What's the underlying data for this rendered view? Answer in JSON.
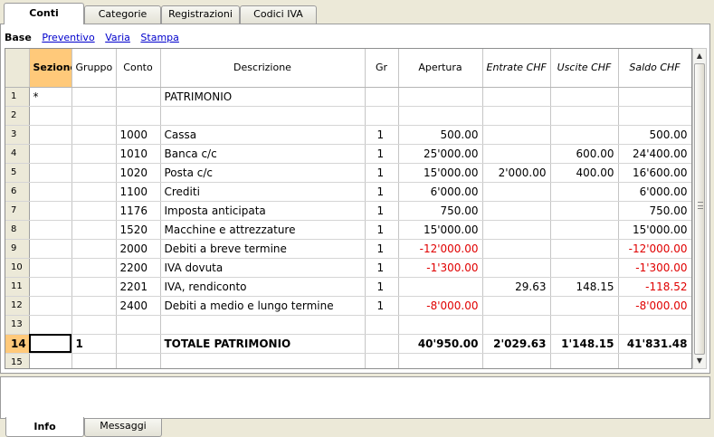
{
  "top_tabs": [
    "Conti",
    "Categorie",
    "Registrazioni",
    "Codici IVA"
  ],
  "views": {
    "active": "Base",
    "links": [
      "Preventivo",
      "Varia",
      "Stampa"
    ]
  },
  "columns": [
    "Sezione",
    "Gruppo",
    "Conto",
    "Descrizione",
    "Gr",
    "Apertura",
    "Entrate CHF",
    "Uscite CHF",
    "Saldo CHF"
  ],
  "rows": [
    {
      "n": "1",
      "sezione": "*",
      "gruppo": "",
      "conto": "",
      "descrizione": "PATRIMONIO",
      "gr": "",
      "apertura": "",
      "entrate": "",
      "uscite": "",
      "saldo": ""
    },
    {
      "n": "2",
      "sezione": "",
      "gruppo": "",
      "conto": "",
      "descrizione": "",
      "gr": "",
      "apertura": "",
      "entrate": "",
      "uscite": "",
      "saldo": ""
    },
    {
      "n": "3",
      "sezione": "",
      "gruppo": "",
      "conto": "1000",
      "descrizione": "Cassa",
      "gr": "1",
      "apertura": "500.00",
      "entrate": "",
      "uscite": "",
      "saldo": "500.00"
    },
    {
      "n": "4",
      "sezione": "",
      "gruppo": "",
      "conto": "1010",
      "descrizione": "Banca c/c",
      "gr": "1",
      "apertura": "25'000.00",
      "entrate": "",
      "uscite": "600.00",
      "saldo": "24'400.00"
    },
    {
      "n": "5",
      "sezione": "",
      "gruppo": "",
      "conto": "1020",
      "descrizione": "Posta c/c",
      "gr": "1",
      "apertura": "15'000.00",
      "entrate": "2'000.00",
      "uscite": "400.00",
      "saldo": "16'600.00"
    },
    {
      "n": "6",
      "sezione": "",
      "gruppo": "",
      "conto": "1100",
      "descrizione": "Crediti",
      "gr": "1",
      "apertura": "6'000.00",
      "entrate": "",
      "uscite": "",
      "saldo": "6'000.00"
    },
    {
      "n": "7",
      "sezione": "",
      "gruppo": "",
      "conto": "1176",
      "descrizione": "Imposta anticipata",
      "gr": "1",
      "apertura": "750.00",
      "entrate": "",
      "uscite": "",
      "saldo": "750.00"
    },
    {
      "n": "8",
      "sezione": "",
      "gruppo": "",
      "conto": "1520",
      "descrizione": "Macchine e attrezzature",
      "gr": "1",
      "apertura": "15'000.00",
      "entrate": "",
      "uscite": "",
      "saldo": "15'000.00"
    },
    {
      "n": "9",
      "sezione": "",
      "gruppo": "",
      "conto": "2000",
      "descrizione": "Debiti a breve termine",
      "gr": "1",
      "apertura": "-12'000.00",
      "entrate": "",
      "uscite": "",
      "saldo": "-12'000.00"
    },
    {
      "n": "10",
      "sezione": "",
      "gruppo": "",
      "conto": "2200",
      "descrizione": "IVA dovuta",
      "gr": "1",
      "apertura": "-1'300.00",
      "entrate": "",
      "uscite": "",
      "saldo": "-1'300.00"
    },
    {
      "n": "11",
      "sezione": "",
      "gruppo": "",
      "conto": "2201",
      "descrizione": "IVA, rendiconto",
      "gr": "1",
      "apertura": "",
      "entrate": "29.63",
      "uscite": "148.15",
      "saldo": "-118.52"
    },
    {
      "n": "12",
      "sezione": "",
      "gruppo": "",
      "conto": "2400",
      "descrizione": "Debiti a medio e lungo termine",
      "gr": "1",
      "apertura": "-8'000.00",
      "entrate": "",
      "uscite": "",
      "saldo": "-8'000.00"
    },
    {
      "n": "13",
      "sezione": "",
      "gruppo": "",
      "conto": "",
      "descrizione": "",
      "gr": "",
      "apertura": "",
      "entrate": "",
      "uscite": "",
      "saldo": ""
    },
    {
      "n": "14",
      "sezione": "",
      "gruppo": "1",
      "conto": "",
      "descrizione": "TOTALE PATRIMONIO",
      "gr": "",
      "apertura": "40'950.00",
      "entrate": "2'029.63",
      "uscite": "1'148.15",
      "saldo": "41'831.48"
    },
    {
      "n": "15",
      "sezione": "",
      "gruppo": "",
      "conto": "",
      "descrizione": "",
      "gr": "",
      "apertura": "",
      "entrate": "",
      "uscite": "",
      "saldo": ""
    }
  ],
  "bottom_tabs": [
    "Info",
    "Messaggi"
  ],
  "colors": {
    "header_selected": "#ffc97a",
    "negative": "#e00000",
    "link": "#0000cc"
  }
}
